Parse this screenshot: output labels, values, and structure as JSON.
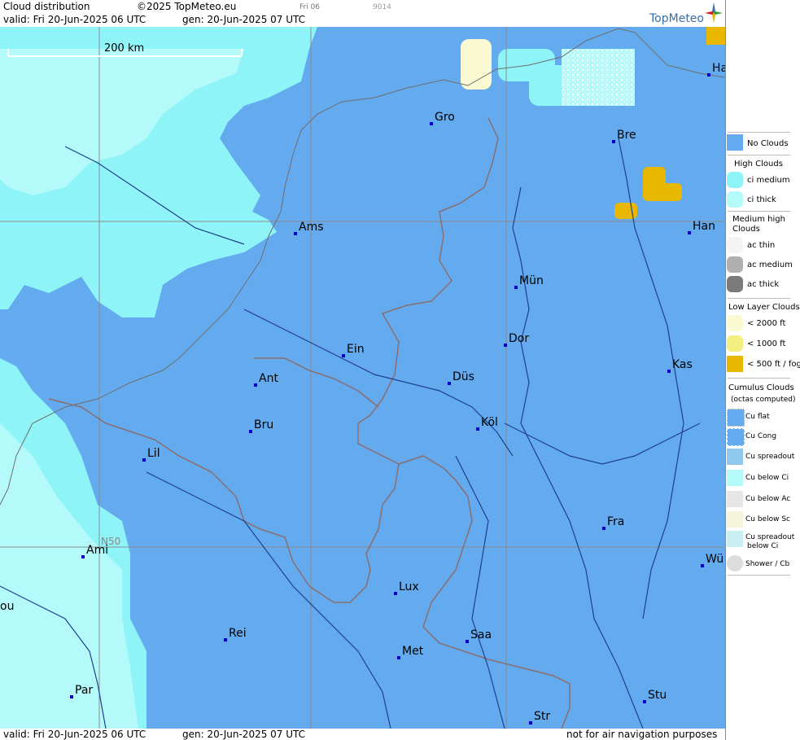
{
  "header": {
    "title": "Cloud distribution",
    "copyright": "©2025 TopMeteo.eu",
    "small_day": "Fri 06",
    "small_code": "9014",
    "valid": "valid:  Fri  20-Jun-2025  06 UTC",
    "gen": "gen: 20-Jun-2025 07 UTC",
    "brand": "TopMeteo"
  },
  "map": {
    "scale_label": "200 km",
    "lat_label": "N50",
    "colors": {
      "no_clouds": "#64aaee",
      "ci_medium": "#8ef4f8",
      "ci_thick": "#b4fafa",
      "fog": "#e8b800",
      "low1000": "#fafad2",
      "border": "#8a6e6e",
      "river": "#1f3f8f"
    },
    "cities": [
      {
        "name": "Ha",
        "id": "ha"
      },
      {
        "name": "Gro",
        "id": "gro"
      },
      {
        "name": "Bre",
        "id": "bre"
      },
      {
        "name": "Ams",
        "id": "ams"
      },
      {
        "name": "Han",
        "id": "han"
      },
      {
        "name": "Mün",
        "id": "mun"
      },
      {
        "name": "Dor",
        "id": "dor"
      },
      {
        "name": "Ein",
        "id": "ein"
      },
      {
        "name": "Kas",
        "id": "kas"
      },
      {
        "name": "Ant",
        "id": "ant"
      },
      {
        "name": "Düs",
        "id": "dus"
      },
      {
        "name": "Köl",
        "id": "kol"
      },
      {
        "name": "Bru",
        "id": "bru"
      },
      {
        "name": "Lil",
        "id": "lil"
      },
      {
        "name": "Fra",
        "id": "fra"
      },
      {
        "name": "Ami",
        "id": "ami"
      },
      {
        "name": "Wü",
        "id": "wu"
      },
      {
        "name": "Lux",
        "id": "lux"
      },
      {
        "name": "ou",
        "id": "ou"
      },
      {
        "name": "Rei",
        "id": "rei"
      },
      {
        "name": "Saa",
        "id": "saa"
      },
      {
        "name": "Met",
        "id": "met"
      },
      {
        "name": "Stu",
        "id": "stu"
      },
      {
        "name": "Par",
        "id": "par"
      },
      {
        "name": "Str",
        "id": "str"
      }
    ]
  },
  "legend": {
    "no_clouds": "No Clouds",
    "high_title": "High Clouds",
    "ci_medium": "ci medium",
    "ci_thick": "ci thick",
    "medium_title_1": "Medium high",
    "medium_title_2": "Clouds",
    "ac_thin": "ac thin",
    "ac_medium": "ac medium",
    "ac_thick": "ac thick",
    "low_title": "Low Layer Clouds",
    "low_2000": "< 2000 ft",
    "low_1000": "< 1000 ft",
    "low_500": "< 500 ft / fog",
    "cu_title_1": "Cumulus Clouds",
    "cu_title_2": "(octas computed)",
    "cu_flat": "Cu flat",
    "cu_cong": "Cu Cong",
    "cu_spreadout": "Cu spreadout",
    "cu_below_ci": "Cu below Ci",
    "cu_below_ac": "Cu below Ac",
    "cu_below_sc": "Cu below Sc",
    "cu_spread_below_ci_1": "Cu spreadout",
    "cu_spread_below_ci_2": "below Ci",
    "shower": "Shower / Cb"
  },
  "footer": {
    "valid": "valid:  Fri  20-Jun-2025  06 UTC",
    "gen": "gen: 20-Jun-2025 07 UTC",
    "disclaimer": "not for air navigation purposes"
  }
}
